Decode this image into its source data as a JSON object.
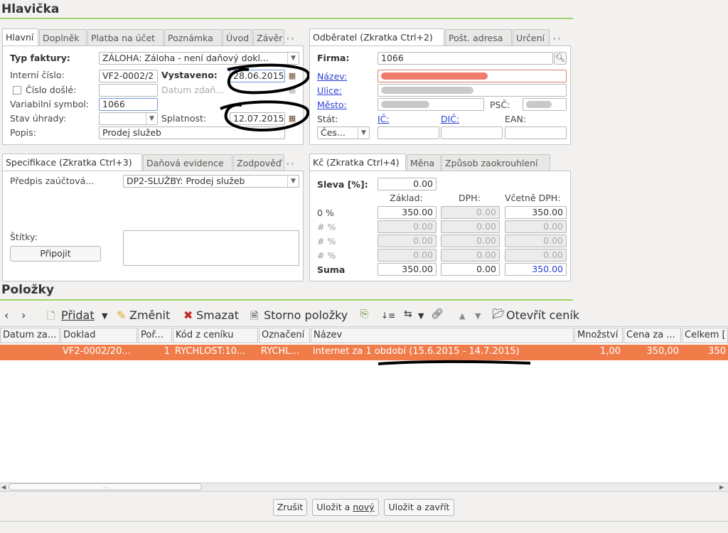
{
  "header_section": {
    "title": "Hlavička"
  },
  "left_tabs": [
    "Hlavní",
    "Doplněk",
    "Platba na účet",
    "Poznámka",
    "Úvod",
    "Závěr"
  ],
  "right_tabs": [
    "Odběratel (Zkratka Ctrl+2)",
    "Pošt. adresa",
    "Určení"
  ],
  "main_form": {
    "typ_faktury_label": "Typ faktury:",
    "typ_faktury_value": "ZÁLOHA: Záloha - není daňový dokl...",
    "interni_cislo_label": "Interní číslo:",
    "interni_cislo_value": "VF2-0002/2",
    "vystaveno_label": "Vystaveno:",
    "vystaveno_value": "28.06.2015",
    "cislo_dosle_label": "Číslo došlé:",
    "datum_zdan_label": "Datum zdaň...",
    "var_symbol_label": "Variabilní symbol:",
    "var_symbol_value": "1066",
    "stav_uhrady_label": "Stav úhrady:",
    "splatnost_label": "Splatnost:",
    "splatnost_value": "12.07.2015",
    "popis_label": "Popis:",
    "popis_value": "Prodej služeb"
  },
  "customer": {
    "firma_label": "Firma:",
    "firma_value": "1066",
    "nazev_label": "Název:",
    "ulice_label": "Ulice:",
    "mesto_label": "Město:",
    "psc_label": "PSČ:",
    "stat_label": "Stát:",
    "stat_value": "Čes...",
    "ic_label": "IČ:",
    "dic_label": "DIČ:",
    "ean_label": "EAN:"
  },
  "spec_tabs": [
    "Specifikace (Zkratka Ctrl+3)",
    "Daňová evidence",
    "Zodpověď"
  ],
  "spec": {
    "predpis_label": "Předpis zaúčtová...",
    "predpis_value": "DP2-SLUŽBY: Prodej služeb",
    "stitky_label": "Štítky:",
    "pripojit_label": "Připojit"
  },
  "currency_tabs": [
    "Kč (Zkratka Ctrl+4)",
    "Měna",
    "Způsob zaokrouhlení"
  ],
  "totals": {
    "sleva_label": "Sleva [%]:",
    "sleva_value": "0.00",
    "col_zaklad": "Základ:",
    "col_dph": "DPH:",
    "col_vcetne": "Včetně DPH:",
    "rows": [
      {
        "label": "0 %",
        "zaklad": "350.00",
        "dph": "0.00",
        "vcetne": "350.00"
      },
      {
        "label": "# %",
        "zaklad": "0.00",
        "dph": "0.00",
        "vcetne": "0.00"
      },
      {
        "label": "# %",
        "zaklad": "0.00",
        "dph": "0.00",
        "vcetne": "0.00"
      },
      {
        "label": "# %",
        "zaklad": "0.00",
        "dph": "0.00",
        "vcetne": "0.00"
      }
    ],
    "suma_label": "Suma",
    "suma_zaklad": "350.00",
    "suma_dph": "0.00",
    "suma_vcetne": "350.00"
  },
  "items_section": {
    "title": "Položky"
  },
  "toolbar": {
    "pridat": "Přidat",
    "zmenit": "Změnit",
    "smazat": "Smazat",
    "storno": "Storno položky",
    "otevrit_cenik": "Otevřít ceník"
  },
  "table": {
    "columns": [
      "Datum za...",
      "Doklad",
      "Poř...",
      "Kód z ceníku",
      "Označení",
      "Název",
      "Množství",
      "Cena za ...",
      "Celkem ["
    ],
    "rows": [
      [
        "",
        "VF2-0002/20...",
        "1",
        "RYCHLOST:10...",
        "RYCHL...",
        "internet za 1 období (15.6.2015 - 14.7.2015)",
        "1,00",
        "350,00",
        "350"
      ]
    ],
    "scroll_dots": "..."
  },
  "footer": {
    "zrusit": "Zrušit",
    "ulozit_novy_a": "Uložit a ",
    "ulozit_novy_b": "nový",
    "ulozit_zavrit": "Uložit a zavřít"
  },
  "colors": {
    "accent_green": "#9ed36a",
    "selected_row": "#f07c4a",
    "link": "#2a3fd6"
  }
}
